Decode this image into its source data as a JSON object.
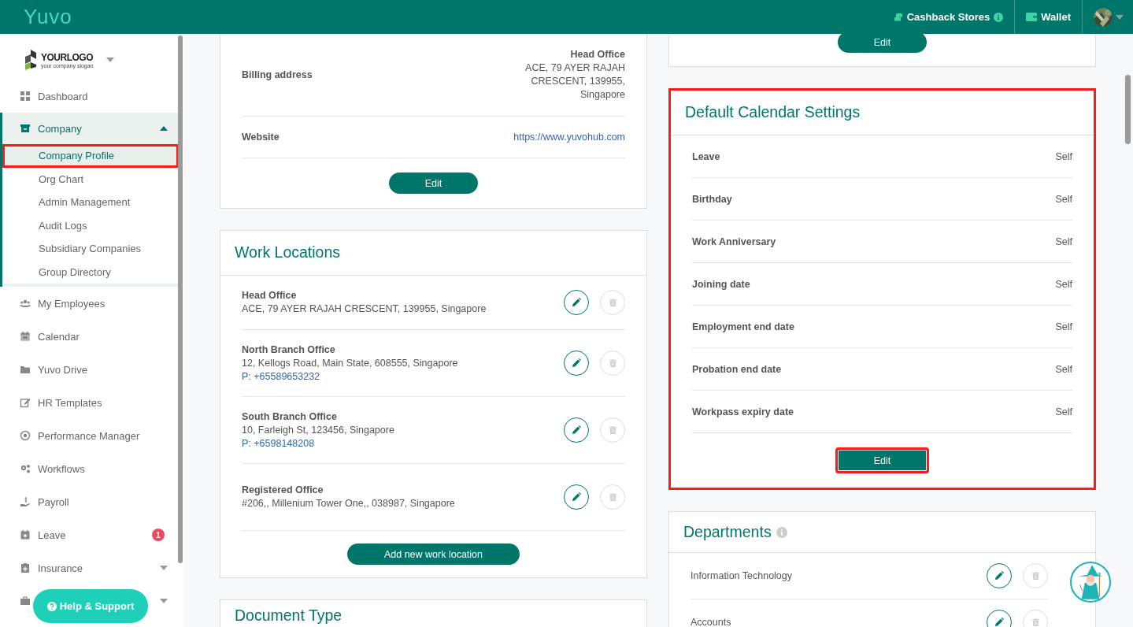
{
  "topbar": {
    "logo": "Yuvo",
    "links": [
      {
        "label": "Cashback Stores",
        "info": true
      },
      {
        "label": "Wallet",
        "info": false
      }
    ]
  },
  "sidebar": {
    "company_logo": {
      "name": "YOURLOGO",
      "slogan": "your company slogan"
    },
    "items": [
      {
        "label": "Dashboard"
      },
      {
        "label": "Company",
        "expanded": true,
        "children": [
          {
            "label": "Company Profile",
            "selected": true,
            "highlighted": true
          },
          {
            "label": "Org Chart",
            "selected": false,
            "highlighted": false
          },
          {
            "label": "Admin Management",
            "selected": false,
            "highlighted": false
          },
          {
            "label": "Audit Logs",
            "selected": false,
            "highlighted": false
          },
          {
            "label": "Subsidiary Companies",
            "selected": false,
            "highlighted": false
          },
          {
            "label": "Group Directory",
            "selected": false,
            "highlighted": false
          }
        ]
      },
      {
        "label": "My Employees"
      },
      {
        "label": "Calendar"
      },
      {
        "label": "Yuvo Drive"
      },
      {
        "label": "HR Templates"
      },
      {
        "label": "Performance Manager"
      },
      {
        "label": "Workflows"
      },
      {
        "label": "Payroll"
      },
      {
        "label": "Leave",
        "badge": "1"
      },
      {
        "label": "Insurance",
        "expanded": false
      },
      {
        "expanded": false
      }
    ],
    "help_button": "Help & Support"
  },
  "left_column": {
    "billing_card": {
      "rows": [
        {
          "kind": "address",
          "label": "Billing address",
          "value_title": "Head Office",
          "value": "ACE, 79 AYER RAJAH CRESCENT, 139955, Singapore"
        },
        {
          "kind": "link",
          "label": "Website",
          "value": "https://www.yuvohub.com"
        }
      ],
      "button": "Edit"
    },
    "work_locations": {
      "title": "Work Locations",
      "items": [
        {
          "name": "Head Office",
          "address": "ACE, 79 AYER RAJAH CRESCENT, 139955, Singapore"
        },
        {
          "name": "North Branch Office",
          "address": "12, Kellogs Road, Main State, 608555, Singapore",
          "phone": "P: +65589653232"
        },
        {
          "name": "South Branch Office",
          "address": "10, Farleigh St, 123456, Singapore",
          "phone": "P: +6598148208"
        },
        {
          "name": "Registered Office",
          "address": "#206,, Millenium Tower One,, 038987, Singapore"
        }
      ],
      "button": "Add new work location"
    },
    "document_type": {
      "title": "Document Type"
    }
  },
  "right_column": {
    "top_card": {
      "button": "Edit"
    },
    "calendar_settings": {
      "title": "Default Calendar Settings",
      "highlighted": true,
      "rows": [
        {
          "label": "Leave",
          "value": "Self"
        },
        {
          "label": "Birthday",
          "value": "Self"
        },
        {
          "label": "Work Anniversary",
          "value": "Self"
        },
        {
          "label": "Joining date",
          "value": "Self"
        },
        {
          "label": "Employment end date",
          "value": "Self"
        },
        {
          "label": "Probation end date",
          "value": "Self"
        },
        {
          "label": "Workpass expiry date",
          "value": "Self"
        }
      ],
      "button": {
        "label": "Edit",
        "highlighted": true
      }
    },
    "departments": {
      "title": "Departments",
      "items": [
        "Information Technology",
        "Accounts"
      ]
    }
  }
}
